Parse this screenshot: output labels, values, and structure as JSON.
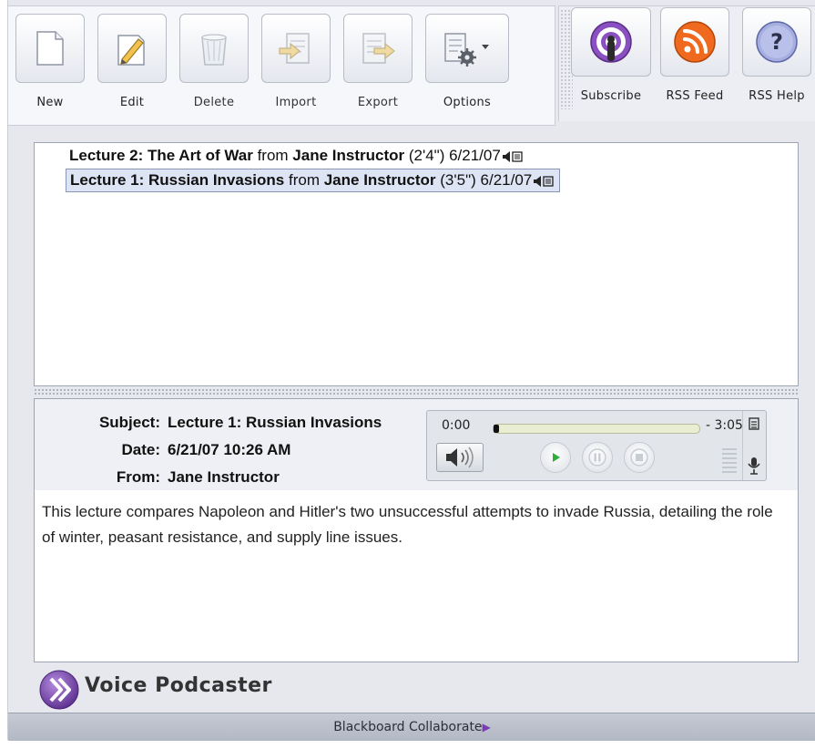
{
  "toolbar": {
    "new_label": "New",
    "edit_label": "Edit",
    "delete_label": "Delete",
    "import_label": "Import",
    "export_label": "Export",
    "options_label": "Options",
    "subscribe_label": "Subscribe",
    "rss_feed_label": "RSS Feed",
    "rss_help_label": "RSS Help"
  },
  "lectures": [
    {
      "title": "Lecture 2: The Art of War",
      "from_word": "from",
      "author": "Jane Instructor",
      "duration": "(2'4\")",
      "date": "6/21/07",
      "selected": false
    },
    {
      "title": "Lecture 1: Russian Invasions",
      "from_word": "from",
      "author": "Jane Instructor",
      "duration": "(3'5\")",
      "date": "6/21/07",
      "selected": true
    }
  ],
  "detail": {
    "subject_label": "Subject:",
    "subject": "Lecture 1: Russian Invasions",
    "date_label": "Date:",
    "date": "6/21/07 10:26 AM",
    "from_label": "From:",
    "from": "Jane Instructor",
    "body": "This lecture compares Napoleon and Hitler's two unsuccessful attempts to invade Russia, detailing the role of winter, peasant resistance, and supply line issues."
  },
  "player": {
    "current_time": "0:00",
    "remaining_time": "- 3:05",
    "progress": 0.0
  },
  "footer": {
    "app_name": "Voice Podcaster",
    "brand": "Blackboard Collaborate"
  },
  "colors": {
    "accent_purple": "#6a3a9a",
    "rss_orange": "#e8611a",
    "play_green": "#2fae3a"
  }
}
